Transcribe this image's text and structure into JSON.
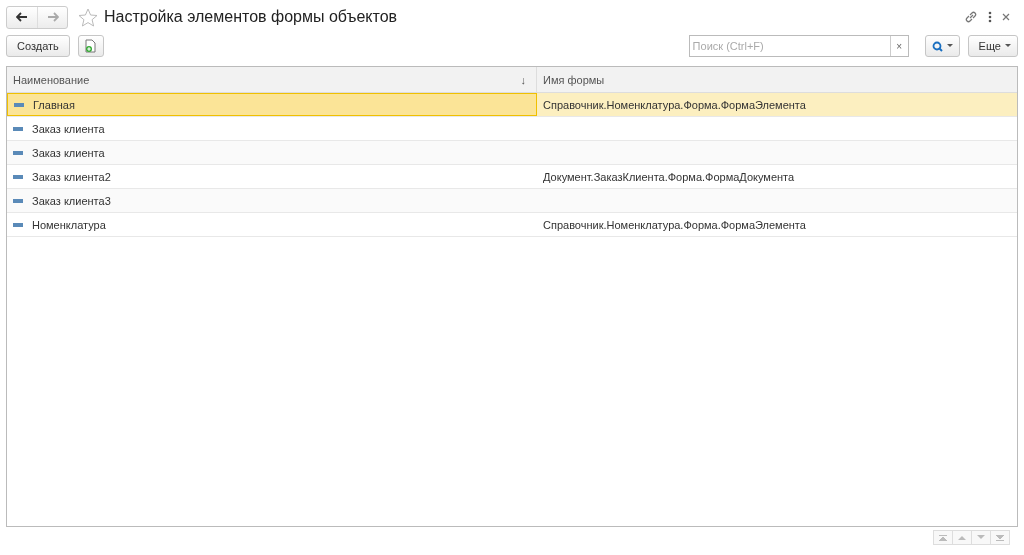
{
  "window": {
    "title": "Настройка элементов формы объектов",
    "favorite": false
  },
  "toolbar": {
    "create_button": "Создать",
    "search": {
      "placeholder": "Поиск (Ctrl+F)",
      "clear": "×"
    },
    "more_button": "Еще"
  },
  "table": {
    "columns": [
      {
        "label": "Наименование",
        "sort": "↓"
      },
      {
        "label": "Имя формы"
      }
    ],
    "rows": [
      {
        "name": "Главная",
        "form": "Справочник.Номенклатура.Форма.ФормаЭлемента",
        "selected": true
      },
      {
        "name": "Заказ клиента",
        "form": "",
        "selected": false
      },
      {
        "name": "Заказ клиента",
        "form": "",
        "selected": false
      },
      {
        "name": "Заказ клиента2",
        "form": "Документ.ЗаказКлиента.Форма.ФормаДокумента",
        "selected": false
      },
      {
        "name": "Заказ клиента3",
        "form": "",
        "selected": false
      },
      {
        "name": "Номенклатура",
        "form": "Справочник.Номенклатура.Форма.ФормаЭлемента",
        "selected": false
      }
    ]
  }
}
